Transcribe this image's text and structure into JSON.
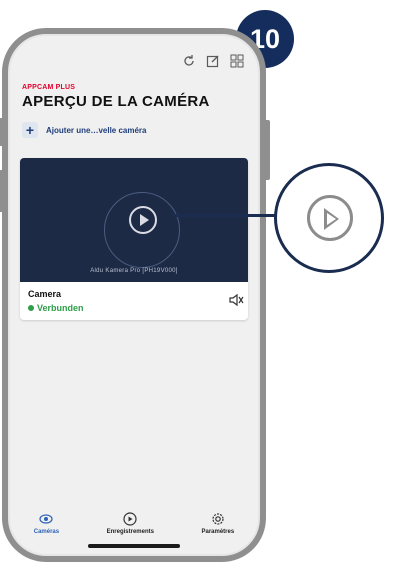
{
  "badge": {
    "number": "10"
  },
  "header": {
    "app_name": "APPCAM PLUS",
    "title": "APERÇU DE LA CAMÉRA"
  },
  "add_camera": {
    "label": "Ajouter une…velle caméra"
  },
  "camera_card": {
    "model": "Aldu Kamera Pro [PH19V000]",
    "name": "Camera",
    "status": "Verbunden",
    "status_color": "#2e9e4a"
  },
  "tabs": [
    {
      "label": "Caméras",
      "icon": "camera-eye-icon",
      "active": true
    },
    {
      "label": "Enregistrements",
      "icon": "play-circle-icon",
      "active": false
    },
    {
      "label": "Paramètres",
      "icon": "gear-icon",
      "active": false
    }
  ],
  "colors": {
    "accent": "#e4002b",
    "navy": "#152d5c",
    "tab_active": "#2c62b8"
  }
}
